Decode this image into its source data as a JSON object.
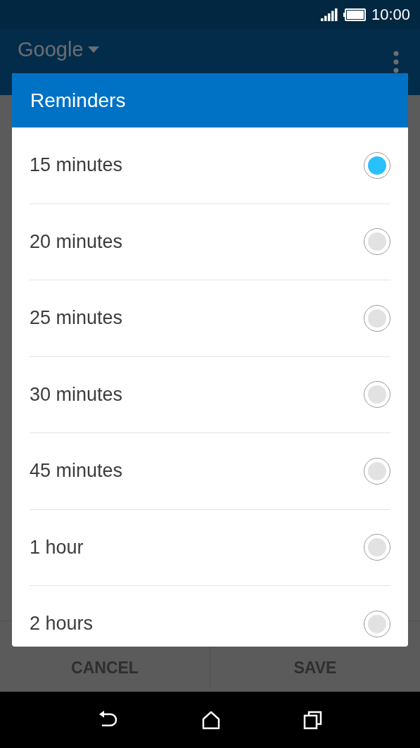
{
  "status_bar": {
    "time": "10:00"
  },
  "app_bar": {
    "account": "Google"
  },
  "dialog": {
    "title": "Reminders",
    "options": [
      {
        "label": "15 minutes",
        "selected": true
      },
      {
        "label": "20 minutes",
        "selected": false
      },
      {
        "label": "25 minutes",
        "selected": false
      },
      {
        "label": "30 minutes",
        "selected": false
      },
      {
        "label": "45 minutes",
        "selected": false
      },
      {
        "label": "1 hour",
        "selected": false
      },
      {
        "label": "2 hours",
        "selected": false
      }
    ]
  },
  "buttons": [
    "CANCEL",
    "SAVE"
  ]
}
